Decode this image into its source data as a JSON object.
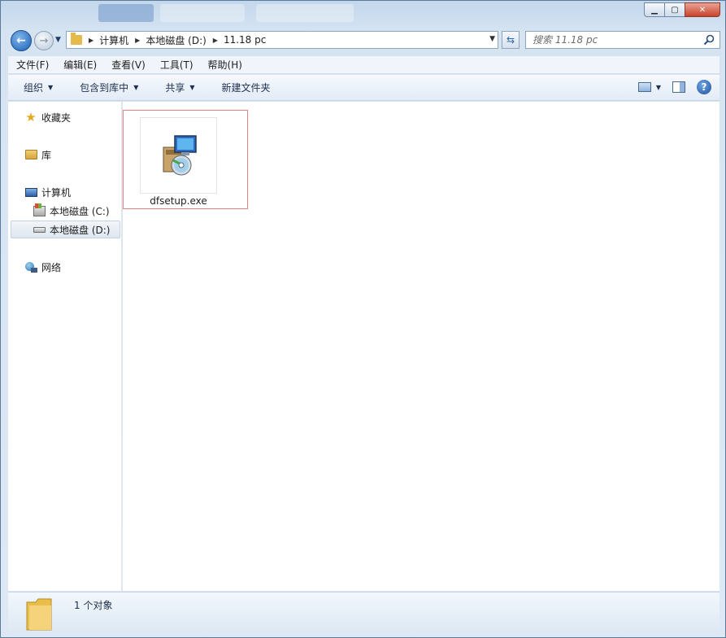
{
  "window": {
    "controls": {
      "minimize": "▁",
      "maximize": "▢",
      "close": "✕"
    }
  },
  "address": {
    "crumbs": [
      "计算机",
      "本地磁盘 (D:)",
      "11.18 pc"
    ]
  },
  "search": {
    "placeholder": "搜索 11.18 pc"
  },
  "menu": [
    "文件(F)",
    "编辑(E)",
    "查看(V)",
    "工具(T)",
    "帮助(H)"
  ],
  "commands": {
    "organize": "组织",
    "include_library": "包含到库中",
    "share": "共享",
    "new_folder": "新建文件夹"
  },
  "nav": {
    "favorites": "收藏夹",
    "libraries": "库",
    "computer": "计算机",
    "drive_c": "本地磁盘 (C:)",
    "drive_d": "本地磁盘 (D:)",
    "network": "网络"
  },
  "files": [
    {
      "name": "dfsetup.exe",
      "icon": "installer-icon"
    }
  ],
  "status": {
    "count": "1 个对象"
  },
  "colors": {
    "selection_border": "#e58282",
    "accent": "#1c5fb3"
  }
}
